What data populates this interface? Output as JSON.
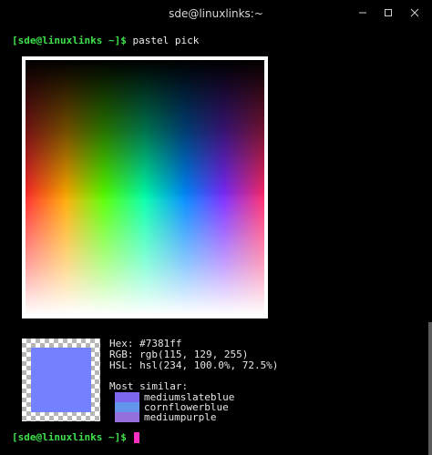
{
  "window": {
    "title": "sde@linuxlinks:~",
    "minimize_icon": "minimize-icon",
    "maximize_icon": "maximize-icon",
    "close_icon": "close-icon"
  },
  "terminal": {
    "line1_prompt": "[sde@linuxlinks ~]$",
    "line1_command": " pastel pick",
    "picker_colors": [
      "#ff2a2a",
      "#ffaa00",
      "#55ff00",
      "#00ffaa",
      "#0088ff",
      "#7a2bff",
      "#ff2a6a"
    ],
    "picked": {
      "color": "#7381ff",
      "hex": "Hex: #7381ff",
      "rgb": "RGB: rgb(115, 129, 255)",
      "hsl": "HSL: hsl(234, 100.0%, 72.5%)"
    },
    "similar_heading": "Most similar:",
    "similar": [
      {
        "name": "mediumslateblue",
        "color": "#7b68ee"
      },
      {
        "name": "cornflowerblue",
        "color": "#6495ed"
      },
      {
        "name": "mediumpurple",
        "color": "#9370db"
      }
    ],
    "line2_prompt": "[sde@linuxlinks ~]$",
    "cursor_color": "#ff2fc2",
    "prompt_color": "#3ee04a"
  }
}
